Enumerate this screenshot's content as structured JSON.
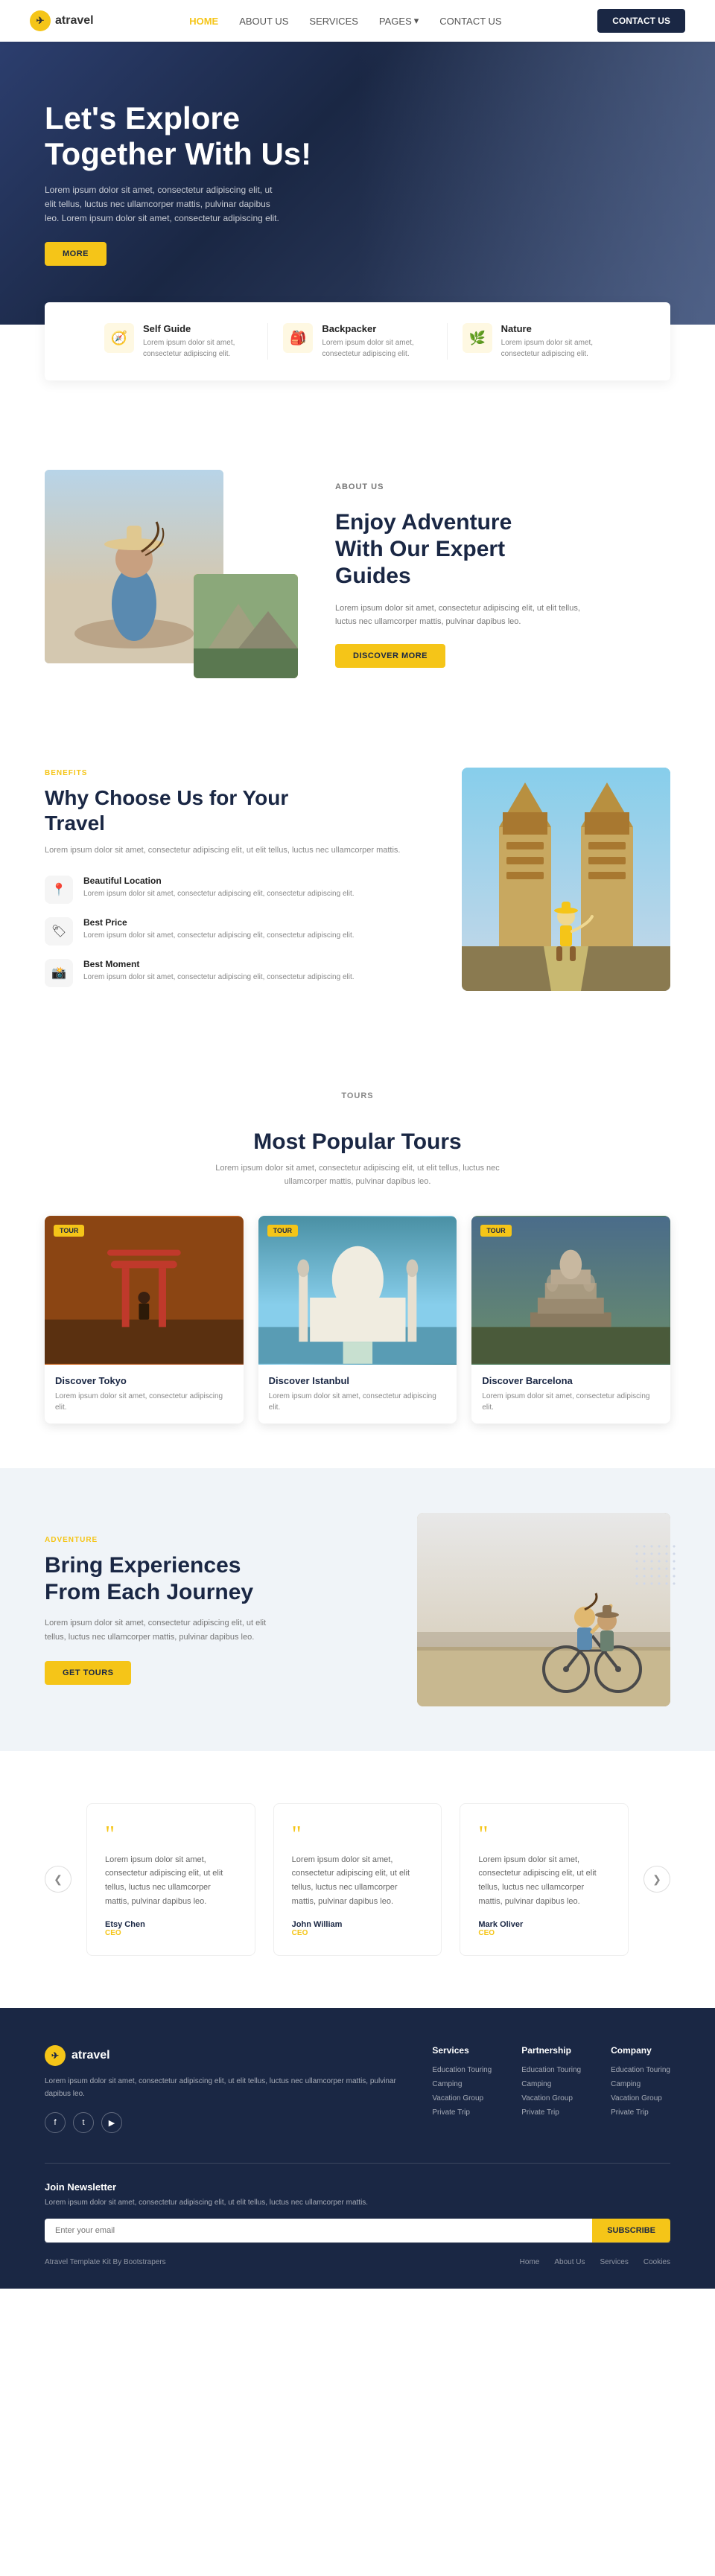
{
  "brand": {
    "name": "atravel",
    "logo_icon": "✈"
  },
  "nav": {
    "links": [
      {
        "label": "HOME",
        "active": true
      },
      {
        "label": "ABOUT US",
        "active": false
      },
      {
        "label": "SERVICES",
        "active": false
      },
      {
        "label": "PAGES",
        "active": false,
        "has_dropdown": true
      },
      {
        "label": "CONTACT US",
        "active": false
      }
    ],
    "cta_label": "CONTACT US"
  },
  "hero": {
    "heading_line1": "Let's Explore",
    "heading_line2": "Together With Us!",
    "description": "Lorem ipsum dolor sit amet, consectetur adipiscing elit, ut elit tellus, luctus nec ullamcorper mattis, pulvinar dapibus leo. Lorem ipsum dolor sit amet, consectetur adipiscing elit.",
    "cta_label": "MORE"
  },
  "features": [
    {
      "icon": "🧭",
      "title": "Self Guide",
      "description": "Lorem ipsum dolor sit amet, consectetur adipiscing elit."
    },
    {
      "icon": "🎒",
      "title": "Backpacker",
      "description": "Lorem ipsum dolor sit amet, consectetur adipiscing elit."
    },
    {
      "icon": "🌿",
      "title": "Nature",
      "description": "Lorem ipsum dolor sit amet, consectetur adipiscing elit."
    }
  ],
  "about": {
    "tag": "ABOUT US",
    "heading_line1": "Enjoy Adventure",
    "heading_line2": "With Our Expert",
    "heading_line3": "Guides",
    "description": "Lorem ipsum dolor sit amet, consectetur adipiscing elit, ut elit tellus, luctus nec ullamcorper mattis, pulvinar dapibus leo.",
    "cta_label": "DISCOVER MORE"
  },
  "why": {
    "tag": "BENEFITS",
    "heading_line1": "Why Choose Us for Your",
    "heading_line2": "Travel",
    "description": "Lorem ipsum dolor sit amet, consectetur adipiscing elit, ut elit tellus, luctus nec ullamcorper mattis.",
    "items": [
      {
        "icon": "📍",
        "title": "Beautiful Location",
        "description": "Lorem ipsum dolor sit amet, consectetur adipiscing elit, consectetur adipiscing elit."
      },
      {
        "icon": "🏷",
        "title": "Best Price",
        "description": "Lorem ipsum dolor sit amet, consectetur adipiscing elit, consectetur adipiscing elit."
      },
      {
        "icon": "📸",
        "title": "Best Moment",
        "description": "Lorem ipsum dolor sit amet, consectetur adipiscing elit, consectetur adipiscing elit."
      }
    ]
  },
  "tours": {
    "tag": "TOURS",
    "heading": "Most Popular Tours",
    "description": "Lorem ipsum dolor sit amet, consectetur adipiscing elit, ut elit tellus, luctus nec ullamcorper mattis, pulvinar dapibus leo.",
    "cards": [
      {
        "badge": "TOUR",
        "title": "Discover Tokyo",
        "description": "Lorem ipsum dolor sit amet, consectetur adipiscing elit.",
        "img_type": "tokyo"
      },
      {
        "badge": "TOUR",
        "title": "Discover Istanbul",
        "description": "Lorem ipsum dolor sit amet, consectetur adipiscing elit.",
        "img_type": "istanbul"
      },
      {
        "badge": "TOUR",
        "title": "Discover Barcelona",
        "description": "Lorem ipsum dolor sit amet, consectetur adipiscing elit.",
        "img_type": "barcelona"
      }
    ]
  },
  "adventure": {
    "tag": "ADVENTURE",
    "heading_line1": "Bring Experiences",
    "heading_line2": "From Each Journey",
    "description": "Lorem ipsum dolor sit amet, consectetur adipiscing elit, ut elit tellus, luctus nec ullamcorper mattis, pulvinar dapibus leo.",
    "cta_label": "GET TOURS"
  },
  "testimonials": {
    "cards": [
      {
        "quote": "Lorem ipsum dolor sit amet, consectetur adipiscing elit, ut elit tellus, luctus nec ullamcorper mattis, pulvinar dapibus leo.",
        "author": "Etsy Chen",
        "role": "CEO"
      },
      {
        "quote": "Lorem ipsum dolor sit amet, consectetur adipiscing elit, ut elit tellus, luctus nec ullamcorper mattis, pulvinar dapibus leo.",
        "author": "John William",
        "role": "CEO"
      },
      {
        "quote": "Lorem ipsum dolor sit amet, consectetur adipiscing elit, ut elit tellus, luctus nec ullamcorper mattis, pulvinar dapibus leo.",
        "author": "Mark Oliver",
        "role": "CEO"
      }
    ],
    "arrow_left": "❮",
    "arrow_right": "❯"
  },
  "footer": {
    "brand_description": "Lorem ipsum dolor sit amet, consectetur adipiscing elit, ut elit tellus, luctus nec ullamcorper mattis, pulvinar dapibus leo.",
    "social": [
      "f",
      "t",
      "▶"
    ],
    "columns": [
      {
        "title": "Services",
        "links": [
          "Education Touring",
          "Camping",
          "Vacation Group",
          "Private Trip"
        ]
      },
      {
        "title": "Partnership",
        "links": [
          "Education Touring",
          "Camping",
          "Vacation Group",
          "Private Trip"
        ]
      },
      {
        "title": "Company",
        "links": [
          "Education Touring",
          "Camping",
          "Vacation Group",
          "Private Trip"
        ]
      }
    ],
    "newsletter_title": "Join Newsletter",
    "newsletter_desc": "Lorem ipsum dolor sit amet, consectetur adipiscing elit, ut elit tellus, luctus nec ullamcorper mattis.",
    "newsletter_placeholder": "Enter your email",
    "newsletter_btn": "SUBSCRIBE",
    "copyright": "Atravel Template Kit By Bootstrapers",
    "bottom_links": [
      "Home",
      "About Us",
      "Services",
      "Cookies"
    ]
  }
}
